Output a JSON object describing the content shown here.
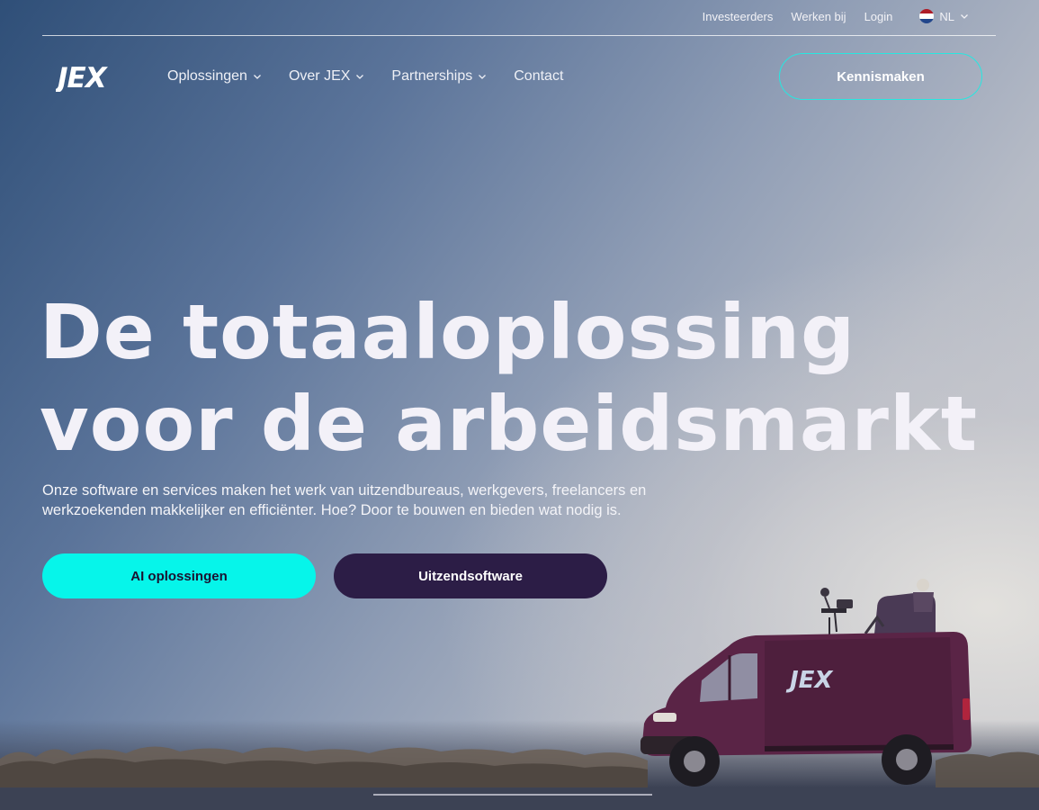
{
  "topbar": {
    "links": [
      "Investeerders",
      "Werken bij",
      "Login"
    ],
    "language": "NL"
  },
  "nav": {
    "logo_text": "JEX",
    "items": [
      {
        "label": "Oplossingen",
        "has_dropdown": true
      },
      {
        "label": "Over JEX",
        "has_dropdown": true
      },
      {
        "label": "Partnerships",
        "has_dropdown": true
      },
      {
        "label": "Contact",
        "has_dropdown": false
      }
    ],
    "cta_label": "Kennismaken"
  },
  "hero": {
    "headline_line1": "De totaaloplossing",
    "headline_line2": "voor de arbeidsmarkt",
    "subtext": "Onze software en services maken het werk van uitzendbureaus, werkgevers, freelancers en werkzoekenden makkelijker en efficiënter. Hoe? Door te bouwen en bieden wat nodig is.",
    "primary_button": "AI oplossingen",
    "secondary_button": "Uitzendsoftware",
    "van_logo_text": "JEX"
  },
  "colors": {
    "accent_cyan": "#06f5ea",
    "outline_cyan": "#27e7e0",
    "dark_purple": "#2c1d46",
    "van_body": "#5a2446"
  },
  "icons": [
    "nl-flag-icon",
    "chevron-down-icon",
    "jex-logo"
  ]
}
